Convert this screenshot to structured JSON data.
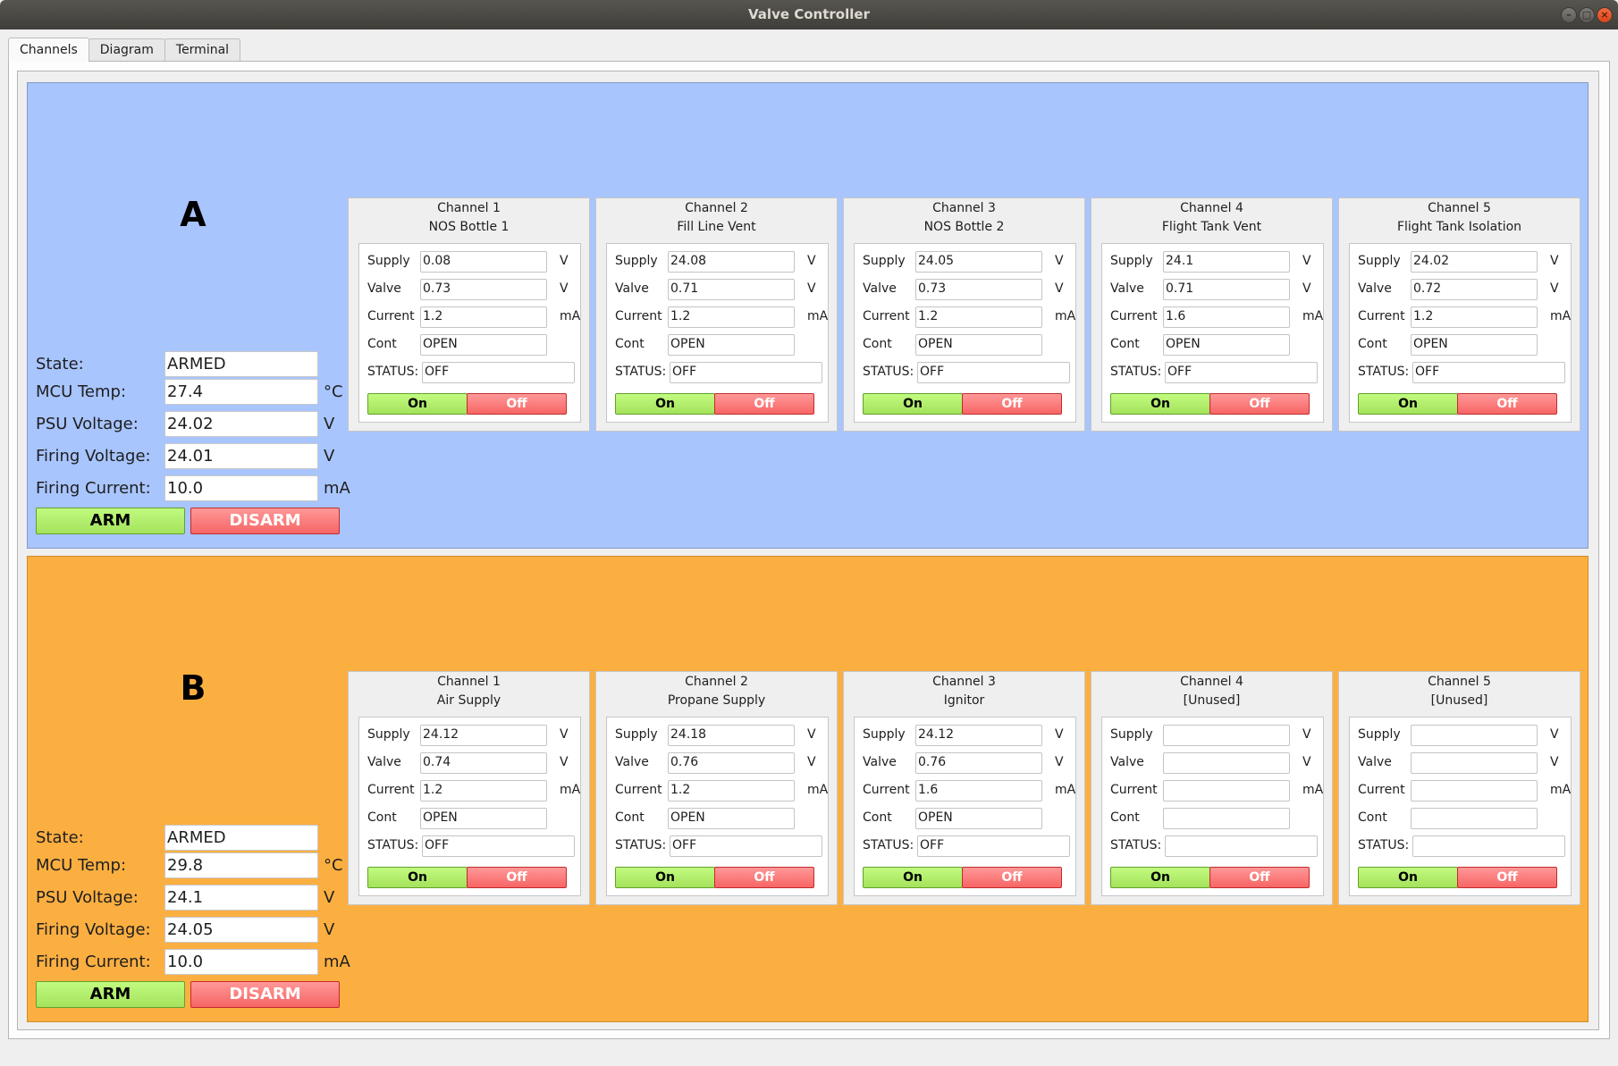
{
  "window": {
    "title": "Valve Controller",
    "controls": [
      "minimize-icon",
      "maximize-icon",
      "close-icon"
    ]
  },
  "tabs": [
    {
      "label": "Channels",
      "active": true
    },
    {
      "label": "Diagram",
      "active": false
    },
    {
      "label": "Terminal",
      "active": false
    }
  ],
  "colors": {
    "panel_a": "#a8c5fe",
    "panel_b": "#fcaf41",
    "on_button": "#a5e25b",
    "off_button": "#f76565"
  },
  "status_labels": {
    "state": "State:",
    "mcu_temp": "MCU Temp:",
    "psu_voltage": "PSU Voltage:",
    "firing_voltage": "Firing Voltage:",
    "firing_current": "Firing Current:",
    "unit_temp": "°C",
    "unit_v": "V",
    "unit_ma": "mA",
    "arm": "ARM",
    "disarm": "DISARM"
  },
  "channel_labels": {
    "supply": "Supply",
    "valve": "Valve",
    "current": "Current",
    "cont": "Cont",
    "status": "STATUS:",
    "unit_v": "V",
    "unit_ma": "mA",
    "on": "On",
    "off": "Off"
  },
  "panels": [
    {
      "letter": "A",
      "state": "ARMED",
      "mcu_temp": "27.4",
      "psu_voltage": "24.02",
      "firing_voltage": "24.01",
      "firing_current": "10.0",
      "channels": [
        {
          "title": "Channel 1",
          "name": "NOS Bottle 1",
          "supply": "0.08",
          "valve": "0.73",
          "current": "1.2",
          "cont": "OPEN",
          "status": "OFF"
        },
        {
          "title": "Channel 2",
          "name": "Fill Line Vent",
          "supply": "24.08",
          "valve": "0.71",
          "current": "1.2",
          "cont": "OPEN",
          "status": "OFF"
        },
        {
          "title": "Channel 3",
          "name": "NOS Bottle 2",
          "supply": "24.05",
          "valve": "0.73",
          "current": "1.2",
          "cont": "OPEN",
          "status": "OFF"
        },
        {
          "title": "Channel 4",
          "name": "Flight Tank Vent",
          "supply": "24.1",
          "valve": "0.71",
          "current": "1.6",
          "cont": "OPEN",
          "status": "OFF"
        },
        {
          "title": "Channel 5",
          "name": "Flight Tank Isolation",
          "supply": "24.02",
          "valve": "0.72",
          "current": "1.2",
          "cont": "OPEN",
          "status": "OFF"
        }
      ]
    },
    {
      "letter": "B",
      "state": "ARMED",
      "mcu_temp": "29.8",
      "psu_voltage": "24.1",
      "firing_voltage": "24.05",
      "firing_current": "10.0",
      "channels": [
        {
          "title": "Channel 1",
          "name": "Air Supply",
          "supply": "24.12",
          "valve": "0.74",
          "current": "1.2",
          "cont": "OPEN",
          "status": "OFF"
        },
        {
          "title": "Channel 2",
          "name": "Propane Supply",
          "supply": "24.18",
          "valve": "0.76",
          "current": "1.2",
          "cont": "OPEN",
          "status": "OFF"
        },
        {
          "title": "Channel 3",
          "name": "Ignitor",
          "supply": "24.12",
          "valve": "0.76",
          "current": "1.6",
          "cont": "OPEN",
          "status": "OFF"
        },
        {
          "title": "Channel 4",
          "name": "[Unused]",
          "supply": "",
          "valve": "",
          "current": "",
          "cont": "",
          "status": ""
        },
        {
          "title": "Channel 5",
          "name": "[Unused]",
          "supply": "",
          "valve": "",
          "current": "",
          "cont": "",
          "status": ""
        }
      ]
    }
  ]
}
